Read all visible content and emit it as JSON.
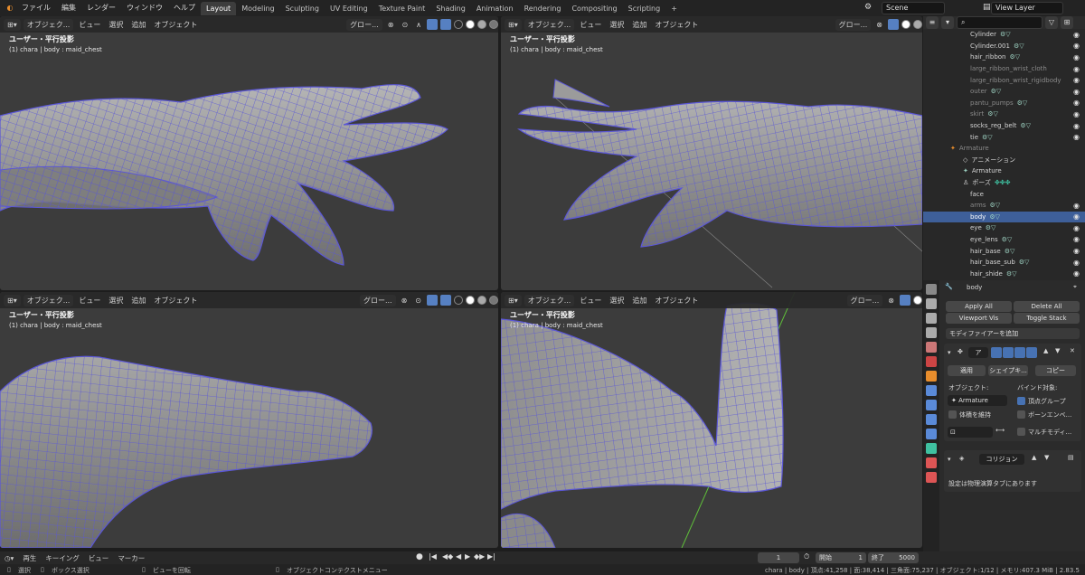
{
  "topbar": {
    "menus": [
      "ファイル",
      "編集",
      "レンダー",
      "ウィンドウ",
      "ヘルプ"
    ],
    "workspaces": [
      "Layout",
      "Modeling",
      "Sculpting",
      "UV Editing",
      "Texture Paint",
      "Shading",
      "Animation",
      "Rendering",
      "Compositing",
      "Scripting"
    ],
    "active_workspace": "Layout",
    "add_tab": "+",
    "scene": "Scene",
    "view_layer": "View Layer"
  },
  "viewport": {
    "mode": "オブジェク...",
    "menus": [
      "ビュー",
      "選択",
      "追加",
      "オブジェクト"
    ],
    "transform": "グロー...",
    "projection": "ユーザー・平行投影",
    "info": "(1) chara | body : maid_chest"
  },
  "outliner": {
    "search_placeholder": "",
    "rows": [
      {
        "name": "Cylinder",
        "dim": true,
        "sel": false
      },
      {
        "name": "Cylinder.001",
        "dim": false,
        "sel": false
      },
      {
        "name": "hair_ribbon",
        "dim": false,
        "sel": false
      },
      {
        "name": "large_ribbon_wrist_cloth",
        "dim": true,
        "sel": false
      },
      {
        "name": "large_ribbon_wrist_rigidbody",
        "dim": true,
        "sel": false
      },
      {
        "name": "outer",
        "dim": true,
        "sel": false
      },
      {
        "name": "pantu_pumps",
        "dim": true,
        "sel": false
      },
      {
        "name": "skirt",
        "dim": true,
        "sel": false
      },
      {
        "name": "socks_reg_belt",
        "dim": false,
        "sel": false
      },
      {
        "name": "tie",
        "dim": false,
        "sel": false
      },
      {
        "name": "Armature",
        "dim": true,
        "sel": false
      },
      {
        "name": "アニメーション",
        "dim": false,
        "sel": false
      },
      {
        "name": "Armature",
        "dim": false,
        "sel": false
      },
      {
        "name": "ポーズ",
        "dim": false,
        "sel": false
      },
      {
        "name": "face",
        "dim": false,
        "sel": false
      },
      {
        "name": "arms",
        "dim": true,
        "sel": false
      },
      {
        "name": "body",
        "dim": false,
        "sel": true
      },
      {
        "name": "eye",
        "dim": false,
        "sel": false
      },
      {
        "name": "eye_lens",
        "dim": false,
        "sel": false
      },
      {
        "name": "hair_base",
        "dim": false,
        "sel": false
      },
      {
        "name": "hair_base_sub",
        "dim": false,
        "sel": false
      },
      {
        "name": "hair_shide",
        "dim": false,
        "sel": false
      }
    ]
  },
  "properties": {
    "object_name": "body",
    "apply_all": "Apply All",
    "delete_all": "Delete All",
    "viewport_vis": "Viewport Vis",
    "toggle_stack": "Toggle Stack",
    "add_modifier": "モディファイアーを追加",
    "mod1_name": "ア",
    "apply": "適用",
    "shapekey": "シェイプキ...",
    "copy": "コピー",
    "object_label": "オブジェクト:",
    "object_value": "Armature",
    "bind_label": "バインド対象:",
    "preserve_volume": "体積を維持",
    "vertex_groups": "頂点グループ",
    "bone_envelopes": "ボーンエンベ...",
    "multi_modifier": "マルチモディ...",
    "collision": "コリジョン",
    "physics_note": "設定は物理演算タブにあります"
  },
  "timeline": {
    "menus": [
      "再生",
      "キーイング",
      "ビュー",
      "マーカー"
    ],
    "current_frame": "1",
    "start_label": "開始",
    "start_value": "1",
    "end_label": "終了",
    "end_value": "5000"
  },
  "status": {
    "select": "選択",
    "box_select": "ボックス選択",
    "rotate_view": "ビューを回転",
    "context_menu": "オブジェクトコンテクストメニュー",
    "stats": "chara | body | 頂点:41,258 | 面:38,414 | 三角面:75,237 | オブジェクト:1/12 | メモリ:407.3 MiB | 2.83.5"
  },
  "colors": {
    "accent": "#3e5f99",
    "mesh_wire": "#5b57d6",
    "mesh_fill": "#8c8c8c",
    "viewport_bg": "#3c3c3c",
    "armature_green": "#4bd04b"
  }
}
